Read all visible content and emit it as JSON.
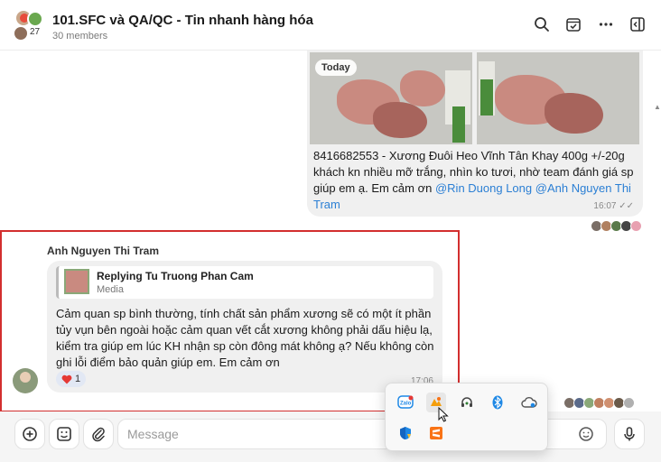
{
  "header": {
    "title": "101.SFC và QA/QC - Tin nhanh hàng hóa",
    "members": "30 members",
    "avatar_count": "27",
    "icons": [
      "search-icon",
      "calendar-check-icon",
      "more-icon",
      "sidebar-toggle-icon"
    ]
  },
  "chat": {
    "date_pill": "Today",
    "outgoing": {
      "text": "8416682553 - Xương Đuôi Heo Vĩnh Tân Khay 400g +/-20g khách kn nhiều mỡ trắng, nhìn ko tươi, nhờ team đánh giá sp giúp em ạ. Em cảm ơn ",
      "mention_1": "@Rin Duong Long",
      "mention_2": "@Anh Nguyen Thi Tram",
      "time": "16:07"
    },
    "incoming": {
      "sender": "Anh Nguyen Thi Tram",
      "reply_title": "Replying Tu Truong Phan Cam",
      "reply_sub": "Media",
      "text": "Cảm quan sp bình thường, tính chất sản phẩm xương sẽ có một ít phần tủy vụn bên ngoài hoặc cảm quan vết cắt xương không phải dấu hiệu lạ, kiểm tra giúp em lúc KH nhận sp còn đông mát không ạ? Nếu không còn ghi lỗi điểm bảo quản giúp em. Em cảm ơn",
      "reaction_count": "1",
      "time": "17:06"
    }
  },
  "composer": {
    "placeholder": "Message",
    "buttons": [
      "add-icon",
      "sticker-icon",
      "attach-icon",
      "emoji-icon",
      "mic-icon"
    ]
  },
  "tray": {
    "icons": [
      "zalo-icon",
      "app-orange-icon",
      "headset-icon",
      "bluetooth-icon",
      "cloud-icon",
      "defender-icon",
      "sublime-icon"
    ]
  },
  "colors": {
    "highlight_border": "#d32f2f",
    "mention": "#2b7fd4",
    "bubble": "#f0f0f0"
  }
}
